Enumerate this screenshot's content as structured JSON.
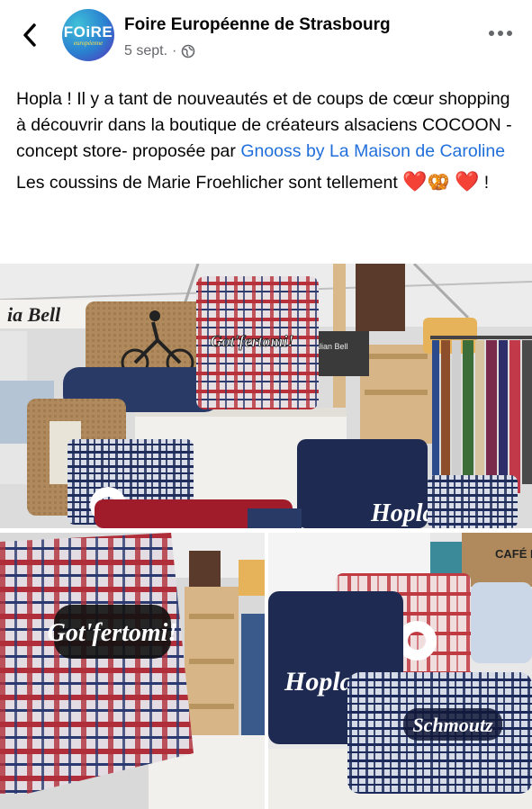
{
  "header": {
    "page_name": "Foire Européenne de Strasbourg",
    "date": "5 sept.",
    "separator": "·",
    "avatar_logo": {
      "main": "FOiRE",
      "sub": "européenne"
    },
    "icons": {
      "back": "chevron-left-icon",
      "privacy": "globe-icon",
      "more": "more-horizontal-icon"
    }
  },
  "post": {
    "line1": "Hopla ! Il y a tant de nouveautés et de coups de cœur shopping à découvrir dans la boutique de créateurs alsaciens COCOON -concept store- proposée par",
    "link_text": "Gnooss by La Maison de Caroline",
    "line2_before": "Les coussins de Marie Froehlicher sont tellement",
    "line2_after": "!",
    "emoji": {
      "heart": "❤️",
      "pretzel": "🥨"
    }
  },
  "photos": {
    "main": {
      "sign": "ia Bell",
      "pillow_text": "Got'fertomi!",
      "hopla_text": "Hopla",
      "crate": "Italian Bell"
    },
    "left": {
      "pillow_text": "Got'fertomi!"
    },
    "right": {
      "hopla_text": "Hopla!",
      "schmoutz_text": "Schmoutz",
      "crate": "CAFÉ BRA"
    }
  },
  "colors": {
    "link": "#216fdb",
    "meta": "#65676b",
    "text": "#050505"
  }
}
